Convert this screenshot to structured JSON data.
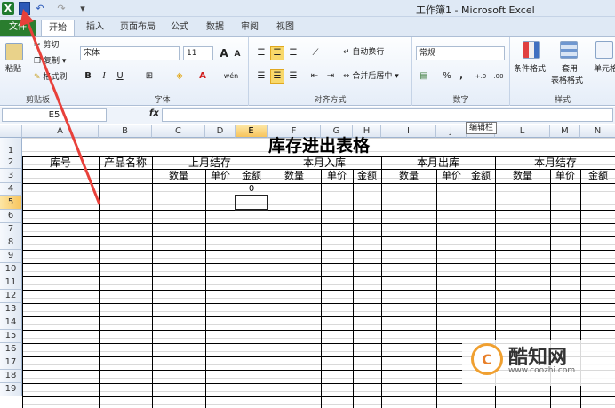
{
  "titlebar": {
    "title": "工作簿1 - Microsoft Excel",
    "excel_icon": "excel-icon",
    "save_icon": "save-icon",
    "undo_icon": "undo-icon",
    "redo_icon": "redo-icon",
    "customize_icon": "qat-customize-icon"
  },
  "tabs": [
    "文件",
    "开始",
    "插入",
    "页面布局",
    "公式",
    "数据",
    "审阅",
    "视图"
  ],
  "ribbon": {
    "clipboard": {
      "label": "剪贴板",
      "paste": "粘贴",
      "cut": "剪切",
      "copy": "复制",
      "format_painter": "格式刷"
    },
    "font": {
      "label": "字体",
      "name": "宋体",
      "size": "11",
      "grow": "A",
      "shrink": "A",
      "bold": "B",
      "italic": "I",
      "underline": "U",
      "phonetic": "wén"
    },
    "alignment": {
      "label": "对齐方式",
      "wrap": "自动换行",
      "merge": "合并后居中"
    },
    "number": {
      "label": "数字",
      "format": "常规",
      "percent": "%",
      "comma": ",",
      "inc_decimal": "+.0",
      "dec_decimal": ".00"
    },
    "styles": {
      "label": "样式",
      "conditional": "条件格式",
      "table": "套用",
      "table2": "表格格式",
      "cell": "单元格"
    }
  },
  "formula_bar": {
    "name_box": "E5",
    "fx": "fx",
    "value": ""
  },
  "tooltip": "编辑栏",
  "columns": [
    "A",
    "B",
    "C",
    "D",
    "E",
    "F",
    "G",
    "H",
    "I",
    "J",
    "K",
    "L",
    "M",
    "N"
  ],
  "active_column": "E",
  "rows": [
    "1",
    "2",
    "3",
    "4",
    "5",
    "6",
    "7",
    "8",
    "9",
    "10",
    "11",
    "12",
    "13",
    "14",
    "15",
    "16",
    "17",
    "18",
    "19"
  ],
  "active_row": "5",
  "sheet": {
    "title": "库存进出表格",
    "headers_row2": [
      "库号",
      "产品名称",
      "上月结存",
      "本月入库",
      "本月出库",
      "本月结存"
    ],
    "headers_row3": [
      "数量",
      "单价",
      "金额",
      "数量",
      "单价",
      "金额",
      "数量",
      "单价",
      "金额",
      "数量",
      "单价",
      "金额"
    ],
    "e4_value": "0"
  },
  "watermark": {
    "name": "酷知网",
    "url": "www.coozhi.com",
    "logo": "C"
  },
  "colors": {
    "file_tab": "#2a7d2e",
    "arrow": "#e8403a",
    "selection": "#f7c45c"
  }
}
